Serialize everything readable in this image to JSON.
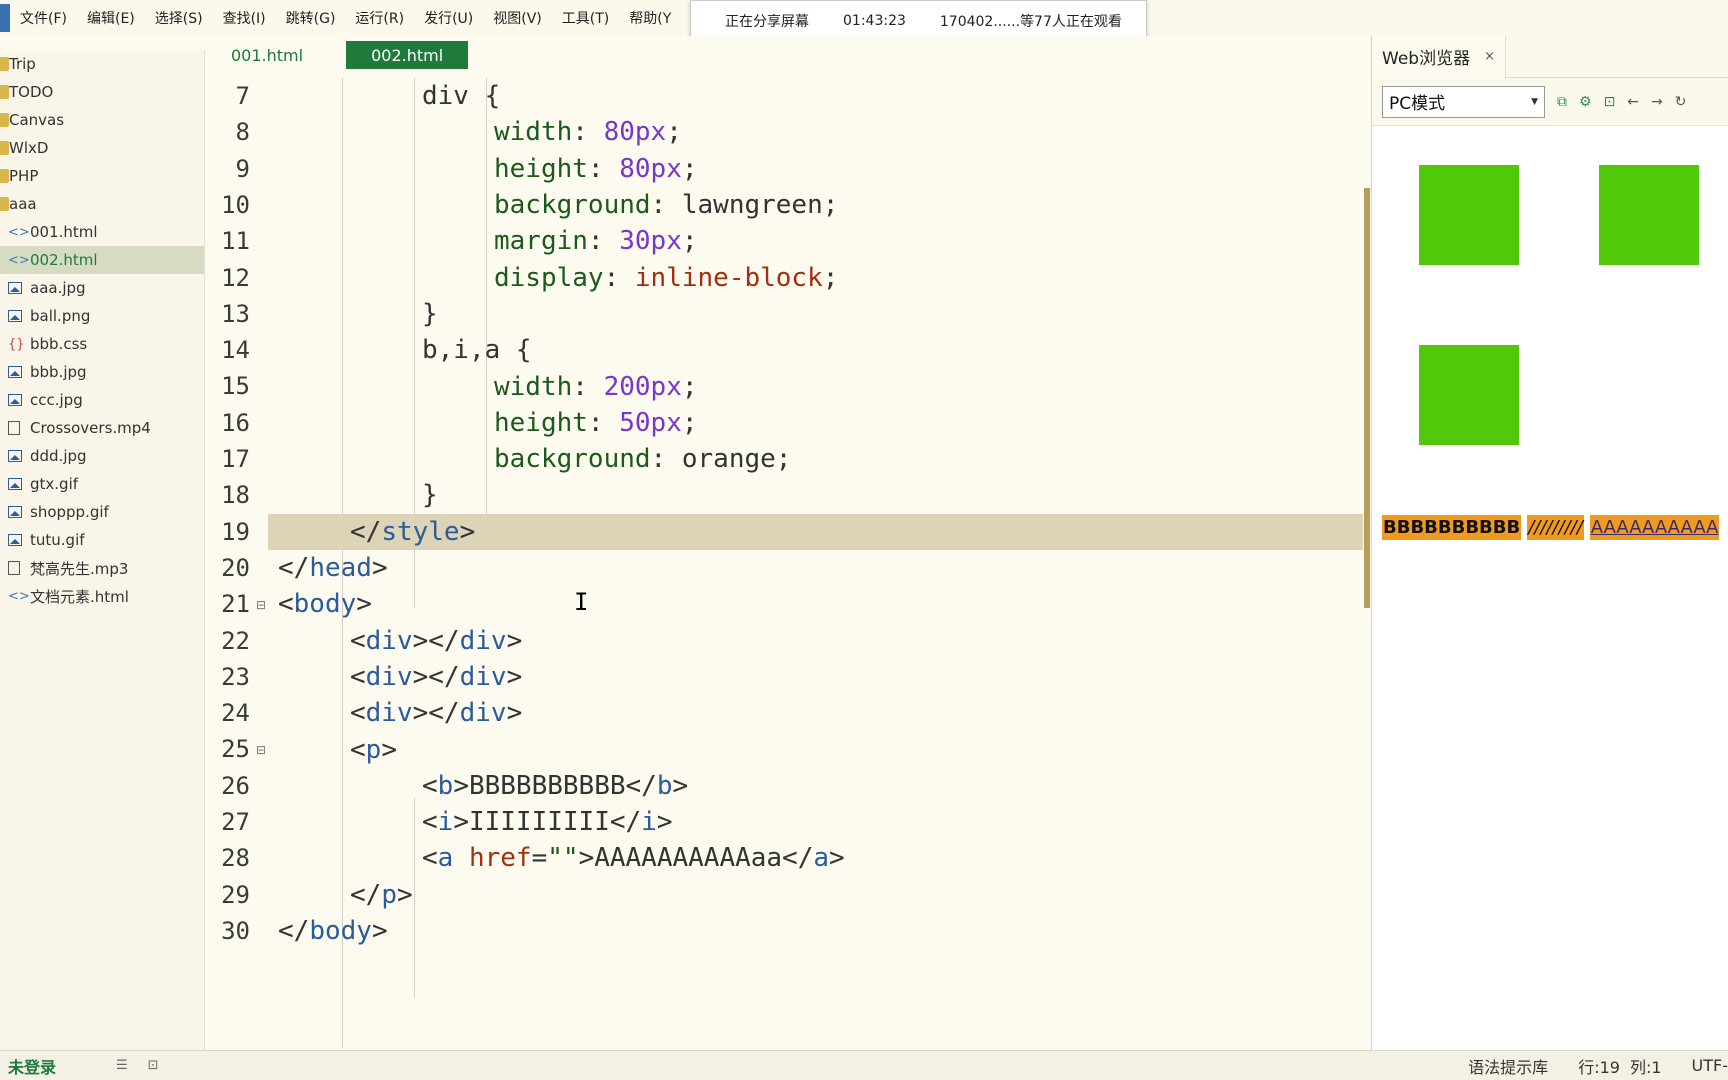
{
  "menu": [
    "文件(F)",
    "编辑(E)",
    "选择(S)",
    "查找(I)",
    "跳转(G)",
    "运行(R)",
    "发行(U)",
    "视图(V)",
    "工具(T)",
    "帮助(Y"
  ],
  "share_banner": {
    "status": "正在分享屏幕",
    "time": "01:43:23",
    "viewers": "170402......等77人正在观看"
  },
  "sidebar": {
    "items": [
      {
        "label": "Trip",
        "type": "folder"
      },
      {
        "label": "TODO",
        "type": "folder"
      },
      {
        "label": "Canvas",
        "type": "folder"
      },
      {
        "label": "WlxD",
        "type": "folder"
      },
      {
        "label": "PHP",
        "type": "folder"
      },
      {
        "label": "aaa",
        "type": "folder"
      },
      {
        "label": "001.html",
        "type": "html"
      },
      {
        "label": "002.html",
        "type": "html",
        "selected": true
      },
      {
        "label": "aaa.jpg",
        "type": "image"
      },
      {
        "label": "ball.png",
        "type": "image"
      },
      {
        "label": "bbb.css",
        "type": "css"
      },
      {
        "label": "bbb.jpg",
        "type": "image"
      },
      {
        "label": "ccc.jpg",
        "type": "image"
      },
      {
        "label": "Crossovers.mp4",
        "type": "file"
      },
      {
        "label": "ddd.jpg",
        "type": "image"
      },
      {
        "label": "gtx.gif",
        "type": "image"
      },
      {
        "label": "shoppp.gif",
        "type": "image"
      },
      {
        "label": "tutu.gif",
        "type": "image"
      },
      {
        "label": "梵高先生.mp3",
        "type": "file"
      },
      {
        "label": "文档元素.html",
        "type": "html"
      }
    ]
  },
  "tabs": [
    {
      "label": "001.html"
    },
    {
      "label": "002.html",
      "active": true
    }
  ],
  "editor": {
    "current_line": 19,
    "lines": [
      {
        "n": "7",
        "indent": 3,
        "tokens": [
          [
            "sel",
            "div {"
          ]
        ]
      },
      {
        "n": "8",
        "indent": 4,
        "tokens": [
          [
            "prop",
            "width"
          ],
          [
            "txt",
            ": "
          ],
          [
            "num",
            "80px"
          ],
          [
            "txt",
            ";"
          ]
        ]
      },
      {
        "n": "9",
        "indent": 4,
        "tokens": [
          [
            "prop",
            "height"
          ],
          [
            "txt",
            ": "
          ],
          [
            "num",
            "80px"
          ],
          [
            "txt",
            ";"
          ]
        ]
      },
      {
        "n": "10",
        "indent": 4,
        "tokens": [
          [
            "prop",
            "background"
          ],
          [
            "txt",
            ": "
          ],
          [
            "txt",
            "lawngreen"
          ],
          [
            "txt",
            ";"
          ]
        ]
      },
      {
        "n": "11",
        "indent": 4,
        "tokens": [
          [
            "prop",
            "margin"
          ],
          [
            "txt",
            ": "
          ],
          [
            "num",
            "30px"
          ],
          [
            "txt",
            ";"
          ]
        ]
      },
      {
        "n": "12",
        "indent": 4,
        "tokens": [
          [
            "prop",
            "display"
          ],
          [
            "txt",
            ": "
          ],
          [
            "val",
            "inline-block"
          ],
          [
            "txt",
            ";"
          ]
        ]
      },
      {
        "n": "13",
        "indent": 3,
        "tokens": [
          [
            "sel",
            "}"
          ]
        ]
      },
      {
        "n": "14",
        "indent": 3,
        "tokens": [
          [
            "sel",
            "b,i,a {"
          ]
        ]
      },
      {
        "n": "15",
        "indent": 4,
        "tokens": [
          [
            "prop",
            "width"
          ],
          [
            "txt",
            ": "
          ],
          [
            "num",
            "200px"
          ],
          [
            "txt",
            ";"
          ]
        ]
      },
      {
        "n": "16",
        "indent": 4,
        "tokens": [
          [
            "prop",
            "height"
          ],
          [
            "txt",
            ": "
          ],
          [
            "num",
            "50px"
          ],
          [
            "txt",
            ";"
          ]
        ]
      },
      {
        "n": "17",
        "indent": 4,
        "tokens": [
          [
            "prop",
            "background"
          ],
          [
            "txt",
            ": "
          ],
          [
            "txt",
            "orange"
          ],
          [
            "txt",
            ";"
          ]
        ]
      },
      {
        "n": "18",
        "indent": 3,
        "tokens": [
          [
            "sel",
            "}"
          ]
        ]
      },
      {
        "n": "19",
        "indent": 2,
        "tokens": [
          [
            "txt",
            "</"
          ],
          [
            "tag",
            "style"
          ],
          [
            "txt",
            ">"
          ]
        ]
      },
      {
        "n": "20",
        "indent": 1,
        "tokens": [
          [
            "txt",
            "</"
          ],
          [
            "tag",
            "head"
          ],
          [
            "txt",
            ">"
          ]
        ]
      },
      {
        "n": "21",
        "indent": 1,
        "fold": true,
        "tokens": [
          [
            "txt",
            "<"
          ],
          [
            "tag",
            "body"
          ],
          [
            "txt",
            ">"
          ]
        ]
      },
      {
        "n": "22",
        "indent": 2,
        "tokens": [
          [
            "txt",
            "<"
          ],
          [
            "tag",
            "div"
          ],
          [
            "txt",
            "></"
          ],
          [
            "tag",
            "div"
          ],
          [
            "txt",
            ">"
          ]
        ]
      },
      {
        "n": "23",
        "indent": 2,
        "tokens": [
          [
            "txt",
            "<"
          ],
          [
            "tag",
            "div"
          ],
          [
            "txt",
            "></"
          ],
          [
            "tag",
            "div"
          ],
          [
            "txt",
            ">"
          ]
        ]
      },
      {
        "n": "24",
        "indent": 2,
        "tokens": [
          [
            "txt",
            "<"
          ],
          [
            "tag",
            "div"
          ],
          [
            "txt",
            "></"
          ],
          [
            "tag",
            "div"
          ],
          [
            "txt",
            ">"
          ]
        ]
      },
      {
        "n": "25",
        "indent": 2,
        "fold": true,
        "tokens": [
          [
            "txt",
            "<"
          ],
          [
            "tag",
            "p"
          ],
          [
            "txt",
            ">"
          ]
        ]
      },
      {
        "n": "26",
        "indent": 3,
        "tokens": [
          [
            "txt",
            "<"
          ],
          [
            "tag",
            "b"
          ],
          [
            "txt",
            ">BBBBBBBBBB</"
          ],
          [
            "tag",
            "b"
          ],
          [
            "txt",
            ">"
          ]
        ]
      },
      {
        "n": "27",
        "indent": 3,
        "tokens": [
          [
            "txt",
            "<"
          ],
          [
            "tag",
            "i"
          ],
          [
            "txt",
            ">IIIIIIIII</"
          ],
          [
            "tag",
            "i"
          ],
          [
            "txt",
            ">"
          ]
        ]
      },
      {
        "n": "28",
        "indent": 3,
        "tokens": [
          [
            "txt",
            "<"
          ],
          [
            "tag",
            "a"
          ],
          [
            "txt",
            " "
          ],
          [
            "attr",
            "href"
          ],
          [
            "txt",
            "="
          ],
          [
            "str",
            "\"\""
          ],
          [
            "txt",
            ">AAAAAAAAAAaa</"
          ],
          [
            "tag",
            "a"
          ],
          [
            "txt",
            ">"
          ]
        ]
      },
      {
        "n": "29",
        "indent": 2,
        "tokens": [
          [
            "txt",
            "</"
          ],
          [
            "tag",
            "p"
          ],
          [
            "txt",
            ">"
          ]
        ]
      },
      {
        "n": "30",
        "indent": 1,
        "tokens": [
          [
            "txt",
            "</"
          ],
          [
            "tag",
            "body"
          ],
          [
            "txt",
            ">"
          ]
        ]
      }
    ]
  },
  "preview": {
    "tab_label": "Web浏览器",
    "close": "×",
    "mode": "PC模式",
    "colors": {
      "box": "#52c80a",
      "inline": "#f09a20"
    },
    "bold_text": "BBBBBBBBBB",
    "italic_text": "/////////",
    "link_text": "AAAAAAAAAA"
  },
  "status": {
    "login": "未登录",
    "hint": "语法提示库",
    "row": "行:19",
    "col": "列:1",
    "encoding": "UTF-"
  }
}
